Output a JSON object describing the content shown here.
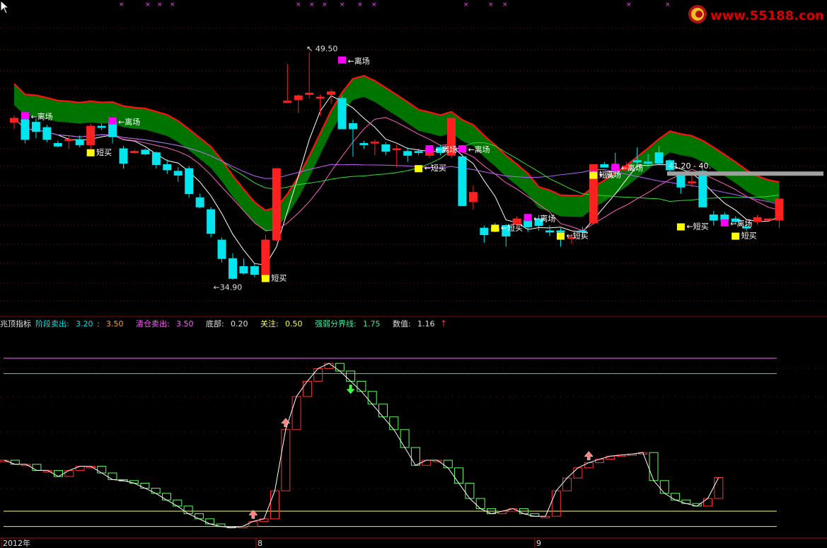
{
  "watermark": {
    "text": "www.55188.com"
  },
  "indicator_bar": {
    "name": "兆顶指标",
    "items": [
      {
        "label": "阶段卖出:",
        "value": "3.20",
        "color": "#00e0e0"
      },
      {
        "label": ":",
        "value": "3.50",
        "color": "#ffa040"
      },
      {
        "label": "清仓卖出:",
        "value": "3.50",
        "color": "#ff60ff"
      },
      {
        "label": "底部:",
        "value": "0.20",
        "color": "#e0e0e0"
      },
      {
        "label": "关注:",
        "value": "0.50",
        "color": "#ffff40"
      },
      {
        "label": "强弱分界线:",
        "value": "1.75",
        "color": "#40e0a0"
      },
      {
        "label": "数值:",
        "value": "1.16",
        "color": "#e0e0e0"
      }
    ],
    "arrow": "↑"
  },
  "xaxis_labels": [
    "2012年",
    "8",
    "9"
  ],
  "colors": {
    "up": "#ff2020",
    "down": "#00e5ee",
    "buy": "#ffff00",
    "sell": "#ff00ff",
    "band": "#007a00",
    "bandEdge": "#ff1010",
    "grid": "#7a1010"
  },
  "chart_data": [
    {
      "type": "candlestick",
      "title": "",
      "price_range": [
        30,
        53
      ],
      "annotations": [
        {
          "text": "←离场",
          "i": 1,
          "price": 44.8,
          "kind": "sell"
        },
        {
          "text": "←离场",
          "i": 9,
          "price": 44.4,
          "kind": "sell"
        },
        {
          "text": "短买",
          "i": 7,
          "price": 42.1,
          "kind": "buy"
        },
        {
          "text": "←离场",
          "i": 30,
          "price": 49.0,
          "kind": "sell"
        },
        {
          "text": "←离场",
          "i": 38,
          "price": 42.3,
          "kind": "sell"
        },
        {
          "text": "←离场",
          "i": 41,
          "price": 42.3,
          "kind": "sell"
        },
        {
          "text": "←短买",
          "i": 37,
          "price": 40.9,
          "kind": "buy"
        },
        {
          "text": "←离场",
          "i": 47,
          "price": 37.1,
          "kind": "sell"
        },
        {
          "text": "←短买",
          "i": 44,
          "price": 36.4,
          "kind": "buy"
        },
        {
          "text": "←短买",
          "i": 50,
          "price": 35.8,
          "kind": "buy"
        },
        {
          "text": "←离场",
          "i": 53,
          "price": 40.4,
          "kind": "sell"
        },
        {
          "text": "←离场",
          "i": 55,
          "price": 40.9,
          "kind": "sell"
        },
        {
          "text": "短买",
          "i": 53,
          "price": 40.4,
          "kind": "buy"
        },
        {
          "text": "←短买",
          "i": 61,
          "price": 36.5,
          "kind": "buy"
        },
        {
          "text": "←离场",
          "i": 65,
          "price": 36.7,
          "kind": "sell"
        },
        {
          "text": "短买",
          "i": 66,
          "price": 35.8,
          "kind": "buy"
        },
        {
          "text": "短买",
          "i": 23,
          "price": 32.6,
          "kind": "buy"
        }
      ],
      "high_label": {
        "text": "49.50",
        "i": 27,
        "price": 49.5
      },
      "low_label": {
        "text": "34.90",
        "i": 19,
        "price": 31.8
      },
      "value_tag": {
        "text": "41.20 - 40.",
        "price": 40.9
      },
      "candles": [
        [
          44.3,
          44.8,
          43.8,
          44.6
        ],
        [
          44.5,
          44.9,
          42.7,
          43.0
        ],
        [
          44.3,
          44.6,
          43.1,
          43.6
        ],
        [
          43.9,
          44.1,
          42.8,
          43.0
        ],
        [
          42.7,
          42.9,
          42.4,
          42.5
        ],
        [
          43.0,
          43.3,
          42.3,
          43.0
        ],
        [
          43.0,
          43.3,
          42.4,
          42.6
        ],
        [
          42.6,
          44.2,
          42.2,
          44.0
        ],
        [
          44.0,
          44.2,
          43.7,
          43.9
        ],
        [
          44.3,
          44.6,
          42.7,
          43.2
        ],
        [
          42.3,
          42.5,
          40.8,
          41.2
        ],
        [
          42.0,
          42.2,
          41.9,
          42.1
        ],
        [
          42.2,
          42.3,
          41.8,
          41.9
        ],
        [
          42.0,
          42.1,
          40.8,
          41.1
        ],
        [
          41.1,
          41.5,
          40.4,
          40.7
        ],
        [
          40.6,
          40.9,
          39.8,
          40.3
        ],
        [
          40.8,
          41.0,
          38.6,
          38.9
        ],
        [
          38.6,
          38.9,
          37.8,
          37.9
        ],
        [
          37.7,
          37.9,
          35.6,
          35.9
        ],
        [
          35.4,
          35.6,
          33.7,
          34.0
        ],
        [
          34.0,
          34.4,
          32.4,
          32.5
        ],
        [
          33.4,
          34.0,
          32.8,
          32.9
        ],
        [
          33.4,
          33.6,
          32.6,
          32.8
        ],
        [
          32.6,
          35.8,
          32.4,
          35.4
        ],
        [
          35.4,
          40.8,
          35.3,
          40.8
        ],
        [
          45.8,
          48.7,
          45.8,
          45.9
        ],
        [
          46.0,
          46.4,
          45.0,
          46.3
        ],
        [
          46.4,
          49.6,
          46.1,
          46.5
        ],
        [
          46.2,
          46.4,
          44.8,
          46.2
        ],
        [
          46.4,
          46.8,
          45.7,
          46.6
        ],
        [
          46.1,
          46.3,
          44.3,
          43.8
        ],
        [
          44.2,
          44.5,
          41.7,
          43.8
        ],
        [
          42.7,
          42.9,
          42.3,
          42.6
        ],
        [
          42.8,
          43.0,
          41.8,
          42.8
        ],
        [
          42.6,
          42.8,
          41.8,
          42.1
        ],
        [
          42.3,
          42.6,
          40.9,
          42.3
        ],
        [
          42.1,
          42.4,
          41.3,
          41.8
        ],
        [
          42.1,
          42.3,
          41.8,
          42.0
        ],
        [
          41.8,
          42.4,
          41.6,
          42.3
        ],
        [
          42.4,
          42.6,
          41.8,
          42.0
        ],
        [
          41.8,
          44.6,
          41.6,
          44.6
        ],
        [
          41.7,
          41.9,
          38.0,
          38.0
        ],
        [
          38.3,
          39.5,
          37.7,
          39.0
        ],
        [
          36.3,
          36.5,
          35.2,
          35.8
        ],
        [
          36.3,
          36.7,
          36.0,
          36.1
        ],
        [
          36.5,
          36.6,
          34.9,
          35.7
        ],
        [
          36.6,
          37.2,
          36.5,
          37.0
        ],
        [
          36.9,
          37.1,
          36.0,
          36.4
        ],
        [
          37.0,
          37.3,
          36.1,
          36.5
        ],
        [
          36.1,
          36.5,
          35.7,
          36.0
        ],
        [
          36.1,
          36.3,
          34.9,
          36.0
        ],
        [
          35.6,
          35.9,
          35.1,
          35.6
        ],
        [
          36.1,
          36.4,
          35.5,
          36.0
        ],
        [
          36.7,
          41.1,
          36.6,
          41.1
        ],
        [
          41.1,
          41.3,
          40.9,
          40.9
        ],
        [
          40.9,
          42.0,
          40.3,
          40.8
        ],
        [
          40.7,
          41.3,
          40.5,
          41.0
        ],
        [
          41.4,
          42.4,
          40.8,
          41.3
        ],
        [
          41.3,
          41.9,
          40.9,
          41.2
        ],
        [
          42.0,
          42.5,
          41.1,
          41.2
        ],
        [
          41.4,
          41.5,
          40.3,
          40.7
        ],
        [
          40.3,
          40.5,
          38.9,
          39.4
        ],
        [
          39.8,
          40.6,
          39.4,
          39.8
        ],
        [
          40.6,
          40.8,
          38.8,
          37.9
        ],
        [
          37.3,
          37.6,
          36.5,
          36.9
        ],
        [
          37.3,
          37.5,
          36.5,
          36.9
        ],
        [
          37.0,
          37.2,
          36.6,
          36.8
        ],
        [
          36.4,
          36.6,
          36.1,
          36.3
        ],
        [
          36.8,
          37.3,
          36.6,
          37.1
        ],
        [
          36.9,
          37.0,
          36.8,
          37.0
        ],
        [
          36.9,
          38.0,
          36.3,
          38.5
        ]
      ]
    },
    {
      "type": "bar",
      "title": "",
      "ylim": [
        0,
        4
      ],
      "levels": [
        {
          "name": "清仓卖出",
          "value": 3.5,
          "color": "#ff60ff"
        },
        {
          "name": "阶段卖出",
          "value": 3.2,
          "color": "#40e0a0"
        },
        {
          "name": "关注",
          "value": 0.5,
          "color": "#ffff60"
        },
        {
          "name": "底部",
          "value": 0.2,
          "color": "#c0ff60"
        }
      ],
      "values": [
        1.5,
        1.42,
        1.42,
        1.3,
        1.3,
        1.18,
        1.3,
        1.38,
        1.38,
        1.25,
        1.12,
        1.1,
        1.05,
        0.95,
        0.85,
        0.72,
        0.6,
        0.45,
        0.35,
        0.25,
        0.2,
        0.18,
        0.2,
        0.3,
        0.35,
        0.9,
        2.1,
        2.75,
        3.05,
        3.3,
        3.4,
        3.25,
        3.05,
        2.85,
        2.6,
        2.35,
        2.1,
        1.75,
        1.4,
        1.5,
        1.5,
        1.35,
        1.05,
        0.75,
        0.55,
        0.45,
        0.5,
        0.55,
        0.45,
        0.4,
        0.4,
        0.9,
        1.15,
        1.35,
        1.45,
        1.52,
        1.58,
        1.6,
        1.62,
        1.65,
        1.1,
        0.85,
        0.72,
        0.65,
        0.6,
        0.75,
        1.16
      ]
    }
  ]
}
